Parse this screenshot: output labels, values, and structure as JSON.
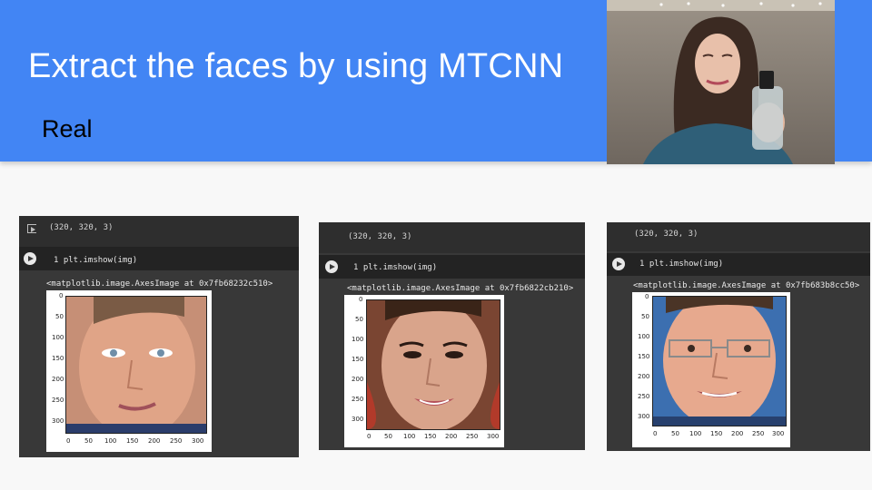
{
  "slide": {
    "title": "Extract the faces by using MTCNN",
    "subtitle": "Real",
    "colors": {
      "header": "#4285f4",
      "background": "#f8f8f8",
      "notebook": "#383838"
    }
  },
  "panels": [
    {
      "shape_text": "(320, 320, 3)",
      "code": "1 plt.imshow(img)",
      "output_repr": "<matplotlib.image.AxesImage at 0x7fb68232c510>",
      "y_ticks": [
        "0",
        "50",
        "100",
        "150",
        "200",
        "250",
        "300"
      ],
      "x_ticks": [
        "0",
        "50",
        "100",
        "150",
        "200",
        "250",
        "300"
      ]
    },
    {
      "shape_text": "(320, 320, 3)",
      "code": "1 plt.imshow(img)",
      "output_repr": "<matplotlib.image.AxesImage at 0x7fb6822cb210>",
      "y_ticks": [
        "0",
        "50",
        "100",
        "150",
        "200",
        "250",
        "300"
      ],
      "x_ticks": [
        "0",
        "50",
        "100",
        "150",
        "200",
        "250",
        "300"
      ]
    },
    {
      "shape_text": "(320, 320, 3)",
      "code": "1 plt.imshow(img)",
      "output_repr": "<matplotlib.image.AxesImage at 0x7fb683b8cc50>",
      "y_ticks": [
        "0",
        "50",
        "100",
        "150",
        "200",
        "250",
        "300"
      ],
      "x_ticks": [
        "0",
        "50",
        "100",
        "150",
        "200",
        "250",
        "300"
      ]
    }
  ]
}
